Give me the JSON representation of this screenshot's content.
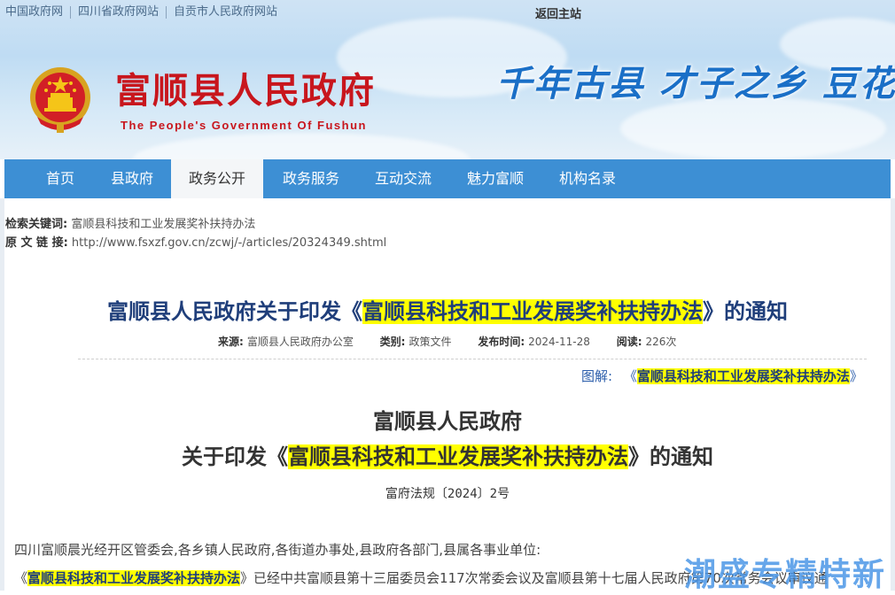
{
  "topbar": {
    "links": [
      "中国政府网",
      "四川省政府网站",
      "自贡市人民政府网站"
    ],
    "back_home": "返回主站"
  },
  "header": {
    "title": "富顺县人民政府",
    "subtitle": "The People's Government Of Fushun",
    "slogan": "千年古县  才子之乡  豆花"
  },
  "nav": {
    "items": [
      "首页",
      "县政府",
      "政务公开",
      "政务服务",
      "互动交流",
      "魅力富顺",
      "机构名录"
    ],
    "active_index": 2
  },
  "info": {
    "keyword_label": "检索关键词:",
    "keyword_value": "富顺县科技和工业发展奖补扶持办法",
    "link_label": "原 文 链 接:",
    "link_value": "http://www.fsxzf.gov.cn/zcwj/-/articles/20324349.shtml"
  },
  "article": {
    "title_pre": "富顺县人民政府关于印发《",
    "title_hl": "富顺县科技和工业发展奖补扶持办法",
    "title_post": "》的通知",
    "meta": {
      "source_label": "来源:",
      "source_value": "富顺县人民政府办公室",
      "category_label": "类别:",
      "category_value": "政策文件",
      "date_label": "发布时间:",
      "date_value": "2024-11-28",
      "views_label": "阅读:",
      "views_value": "226次"
    },
    "tujie_label": "图解:",
    "tujie_pre": "《",
    "tujie_hl": "富顺县科技和工业发展奖补扶持办法",
    "tujie_post": "》",
    "doc_heading1": "富顺县人民政府",
    "doc_heading2_pre": "关于印发《",
    "doc_heading2_hl": "富顺县科技和工业发展奖补扶持办法",
    "doc_heading2_post": "》的通知",
    "doc_number": "富府法规〔2024〕2号",
    "para1": "四川富顺晨光经开区管委会,各乡镇人民政府,各街道办事处,县政府各部门,县属各事业单位:",
    "para2_pre": "《",
    "para2_hl": "富顺县科技和工业发展奖补扶持办法",
    "para2_post": "》已经中共富顺县第十三届委员会117次常委会议及富顺县第十七届人民政府第70次常务会议审议通"
  },
  "watermark": "潮盛专精特新",
  "colors": {
    "nav": "#3d8fd4",
    "title_red": "#c8161d",
    "highlight": "#ffff00",
    "slogan_blue": "#1a6fc7"
  }
}
